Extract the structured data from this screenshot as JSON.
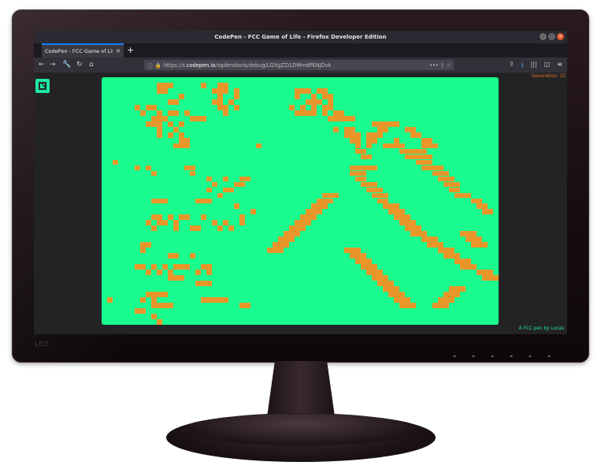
{
  "browser": {
    "window_title": "CodePen - FCC Game of Life - Firefox Developer Edition",
    "tab_title": "CodePen - FCC Game of Life",
    "tab_close": "✕",
    "new_tab": "+",
    "url_prefix": "https://s.",
    "url_domain": "codepen.io",
    "url_path": "/ogdendavis/debug/LQXgZZ/LDMmdPENJDvk",
    "nav": {
      "back": "←",
      "forward": "→",
      "tools": "🔧",
      "reload": "↻",
      "home": "⌂"
    },
    "url_icons": {
      "info": "ⓘ",
      "lock": "🔒",
      "more": "•••",
      "pocket": "◊",
      "star": "☆"
    },
    "right_icons": {
      "share": "⇪",
      "download": "⭳",
      "library": "|||",
      "sidebar": "◫",
      "menu": "≡"
    },
    "win_controls": [
      "–",
      "□",
      "✕"
    ]
  },
  "app": {
    "generation_label": "Generation: 33",
    "footer": "A FCC pen by Lucas",
    "colors": {
      "board": "#19fb8e",
      "cell": "#e8962a",
      "accent": "#1de9a0",
      "generation": "#e07020"
    },
    "board_cols": 72,
    "board_rows": 45,
    "live_cells": [
      [
        10,
        1
      ],
      [
        11,
        1
      ],
      [
        12,
        1
      ],
      [
        18,
        1
      ],
      [
        21,
        1
      ],
      [
        22,
        1
      ],
      [
        10,
        2
      ],
      [
        11,
        2
      ],
      [
        20,
        2
      ],
      [
        21,
        2
      ],
      [
        22,
        2
      ],
      [
        24,
        2
      ],
      [
        14,
        3
      ],
      [
        21,
        3
      ],
      [
        24,
        3
      ],
      [
        12,
        4
      ],
      [
        13,
        4
      ],
      [
        20,
        4
      ],
      [
        21,
        4
      ],
      [
        23,
        4
      ],
      [
        6,
        5
      ],
      [
        8,
        5
      ],
      [
        9,
        5
      ],
      [
        21,
        5
      ],
      [
        22,
        5
      ],
      [
        24,
        5
      ],
      [
        7,
        6
      ],
      [
        10,
        6
      ],
      [
        12,
        6
      ],
      [
        13,
        6
      ],
      [
        15,
        6
      ],
      [
        22,
        6
      ],
      [
        9,
        7
      ],
      [
        10,
        7
      ],
      [
        11,
        7
      ],
      [
        16,
        7
      ],
      [
        17,
        7
      ],
      [
        18,
        7
      ],
      [
        8,
        8
      ],
      [
        9,
        8
      ],
      [
        10,
        8
      ],
      [
        12,
        8
      ],
      [
        14,
        8
      ],
      [
        10,
        9
      ],
      [
        13,
        9
      ],
      [
        10,
        10
      ],
      [
        12,
        10
      ],
      [
        14,
        10
      ],
      [
        14,
        11
      ],
      [
        15,
        11
      ],
      [
        13,
        12
      ],
      [
        14,
        12
      ],
      [
        15,
        12
      ],
      [
        28,
        12
      ],
      [
        2,
        15
      ],
      [
        6,
        16
      ],
      [
        8,
        16
      ],
      [
        15,
        16
      ],
      [
        16,
        16
      ],
      [
        9,
        17
      ],
      [
        16,
        17
      ],
      [
        19,
        18
      ],
      [
        22,
        18
      ],
      [
        25,
        18
      ],
      [
        26,
        18
      ],
      [
        20,
        19
      ],
      [
        24,
        19
      ],
      [
        25,
        19
      ],
      [
        19,
        20
      ],
      [
        22,
        20
      ],
      [
        23,
        20
      ],
      [
        21,
        21
      ],
      [
        9,
        22
      ],
      [
        10,
        22
      ],
      [
        11,
        22
      ],
      [
        17,
        22
      ],
      [
        18,
        22
      ],
      [
        19,
        22
      ],
      [
        24,
        23
      ],
      [
        27,
        24
      ],
      [
        9,
        25
      ],
      [
        10,
        25
      ],
      [
        12,
        25
      ],
      [
        14,
        25
      ],
      [
        15,
        25
      ],
      [
        18,
        25
      ],
      [
        25,
        25
      ],
      [
        8,
        26
      ],
      [
        10,
        26
      ],
      [
        11,
        26
      ],
      [
        13,
        26
      ],
      [
        20,
        26
      ],
      [
        22,
        26
      ],
      [
        25,
        26
      ],
      [
        9,
        27
      ],
      [
        13,
        27
      ],
      [
        16,
        27
      ],
      [
        17,
        27
      ],
      [
        21,
        27
      ],
      [
        23,
        27
      ],
      [
        7,
        30
      ],
      [
        8,
        30
      ],
      [
        7,
        31
      ],
      [
        12,
        32
      ],
      [
        13,
        32
      ],
      [
        16,
        32
      ],
      [
        6,
        34
      ],
      [
        7,
        34
      ],
      [
        9,
        34
      ],
      [
        11,
        34
      ],
      [
        13,
        34
      ],
      [
        14,
        34
      ],
      [
        15,
        34
      ],
      [
        18,
        34
      ],
      [
        19,
        34
      ],
      [
        8,
        35
      ],
      [
        10,
        35
      ],
      [
        12,
        35
      ],
      [
        17,
        35
      ],
      [
        19,
        35
      ],
      [
        12,
        36
      ],
      [
        13,
        36
      ],
      [
        14,
        36
      ],
      [
        17,
        37
      ],
      [
        18,
        37
      ],
      [
        19,
        37
      ],
      [
        8,
        39
      ],
      [
        9,
        39
      ],
      [
        10,
        39
      ],
      [
        11,
        39
      ],
      [
        7,
        40
      ],
      [
        9,
        40
      ],
      [
        9,
        41
      ],
      [
        10,
        41
      ],
      [
        11,
        41
      ],
      [
        12,
        41
      ],
      [
        1,
        40
      ],
      [
        6,
        42
      ],
      [
        7,
        42
      ],
      [
        18,
        40
      ],
      [
        19,
        40
      ],
      [
        20,
        40
      ],
      [
        21,
        40
      ],
      [
        22,
        40
      ],
      [
        25,
        41
      ],
      [
        26,
        41
      ],
      [
        9,
        43
      ],
      [
        10,
        44
      ],
      [
        35,
        2
      ],
      [
        36,
        2
      ],
      [
        37,
        2
      ],
      [
        39,
        2
      ],
      [
        40,
        2
      ],
      [
        35,
        3
      ],
      [
        38,
        3
      ],
      [
        40,
        3
      ],
      [
        41,
        3
      ],
      [
        37,
        4
      ],
      [
        38,
        4
      ],
      [
        39,
        4
      ],
      [
        41,
        4
      ],
      [
        34,
        5
      ],
      [
        36,
        5
      ],
      [
        38,
        5
      ],
      [
        40,
        5
      ],
      [
        41,
        5
      ],
      [
        35,
        6
      ],
      [
        36,
        6
      ],
      [
        37,
        6
      ],
      [
        38,
        6
      ],
      [
        40,
        6
      ],
      [
        42,
        6
      ],
      [
        43,
        6
      ],
      [
        41,
        7
      ],
      [
        42,
        7
      ],
      [
        43,
        7
      ],
      [
        44,
        7
      ],
      [
        45,
        7
      ],
      [
        49,
        8
      ],
      [
        50,
        8
      ],
      [
        51,
        8
      ],
      [
        52,
        8
      ],
      [
        53,
        8
      ],
      [
        42,
        9
      ],
      [
        44,
        9
      ],
      [
        45,
        9
      ],
      [
        50,
        9
      ],
      [
        51,
        9
      ],
      [
        55,
        9
      ],
      [
        56,
        9
      ],
      [
        44,
        10
      ],
      [
        45,
        10
      ],
      [
        46,
        10
      ],
      [
        48,
        10
      ],
      [
        49,
        10
      ],
      [
        50,
        10
      ],
      [
        56,
        10
      ],
      [
        57,
        10
      ],
      [
        45,
        11
      ],
      [
        46,
        11
      ],
      [
        48,
        11
      ],
      [
        49,
        11
      ],
      [
        53,
        11
      ],
      [
        58,
        11
      ],
      [
        59,
        11
      ],
      [
        46,
        12
      ],
      [
        48,
        12
      ],
      [
        51,
        12
      ],
      [
        52,
        12
      ],
      [
        53,
        12
      ],
      [
        54,
        12
      ],
      [
        58,
        12
      ],
      [
        59,
        12
      ],
      [
        60,
        12
      ],
      [
        46,
        13
      ],
      [
        47,
        13
      ],
      [
        54,
        13
      ],
      [
        55,
        13
      ],
      [
        56,
        13
      ],
      [
        57,
        13
      ],
      [
        58,
        13
      ],
      [
        47,
        14
      ],
      [
        48,
        14
      ],
      [
        55,
        14
      ],
      [
        56,
        14
      ],
      [
        57,
        14
      ],
      [
        58,
        14
      ],
      [
        59,
        14
      ],
      [
        57,
        15
      ],
      [
        58,
        15
      ],
      [
        59,
        15
      ],
      [
        45,
        16
      ],
      [
        46,
        16
      ],
      [
        47,
        16
      ],
      [
        48,
        16
      ],
      [
        49,
        16
      ],
      [
        58,
        16
      ],
      [
        59,
        16
      ],
      [
        60,
        16
      ],
      [
        61,
        16
      ],
      [
        45,
        17
      ],
      [
        46,
        17
      ],
      [
        47,
        17
      ],
      [
        60,
        17
      ],
      [
        61,
        17
      ],
      [
        62,
        17
      ],
      [
        46,
        18
      ],
      [
        47,
        18
      ],
      [
        61,
        18
      ],
      [
        62,
        18
      ],
      [
        63,
        18
      ],
      [
        47,
        19
      ],
      [
        48,
        19
      ],
      [
        49,
        19
      ],
      [
        62,
        19
      ],
      [
        63,
        19
      ],
      [
        64,
        19
      ],
      [
        48,
        20
      ],
      [
        49,
        20
      ],
      [
        50,
        20
      ],
      [
        63,
        20
      ],
      [
        64,
        20
      ],
      [
        49,
        21
      ],
      [
        50,
        21
      ],
      [
        51,
        21
      ],
      [
        64,
        21
      ],
      [
        65,
        21
      ],
      [
        66,
        21
      ],
      [
        50,
        22
      ],
      [
        51,
        22
      ],
      [
        67,
        22
      ],
      [
        68,
        22
      ],
      [
        51,
        23
      ],
      [
        52,
        23
      ],
      [
        53,
        23
      ],
      [
        68,
        23
      ],
      [
        69,
        23
      ],
      [
        52,
        24
      ],
      [
        53,
        24
      ],
      [
        54,
        24
      ],
      [
        69,
        24
      ],
      [
        70,
        24
      ],
      [
        53,
        25
      ],
      [
        54,
        25
      ],
      [
        55,
        25
      ],
      [
        54,
        26
      ],
      [
        55,
        26
      ],
      [
        56,
        26
      ],
      [
        55,
        27
      ],
      [
        56,
        27
      ],
      [
        57,
        27
      ],
      [
        56,
        28
      ],
      [
        57,
        28
      ],
      [
        58,
        28
      ],
      [
        58,
        29
      ],
      [
        59,
        29
      ],
      [
        60,
        29
      ],
      [
        59,
        30
      ],
      [
        60,
        30
      ],
      [
        61,
        30
      ],
      [
        61,
        31
      ],
      [
        62,
        31
      ],
      [
        63,
        31
      ],
      [
        62,
        32
      ],
      [
        63,
        32
      ],
      [
        64,
        32
      ],
      [
        64,
        33
      ],
      [
        65,
        33
      ],
      [
        66,
        33
      ],
      [
        65,
        34
      ],
      [
        66,
        34
      ],
      [
        67,
        34
      ],
      [
        68,
        35
      ],
      [
        69,
        35
      ],
      [
        70,
        35
      ],
      [
        69,
        36
      ],
      [
        70,
        36
      ],
      [
        71,
        36
      ],
      [
        40,
        21
      ],
      [
        41,
        21
      ],
      [
        42,
        21
      ],
      [
        39,
        22
      ],
      [
        40,
        22
      ],
      [
        41,
        22
      ],
      [
        38,
        23
      ],
      [
        39,
        23
      ],
      [
        40,
        23
      ],
      [
        37,
        24
      ],
      [
        38,
        24
      ],
      [
        39,
        24
      ],
      [
        36,
        25
      ],
      [
        37,
        25
      ],
      [
        38,
        25
      ],
      [
        35,
        26
      ],
      [
        36,
        26
      ],
      [
        37,
        26
      ],
      [
        34,
        27
      ],
      [
        35,
        27
      ],
      [
        36,
        27
      ],
      [
        33,
        28
      ],
      [
        34,
        28
      ],
      [
        35,
        28
      ],
      [
        32,
        29
      ],
      [
        33,
        29
      ],
      [
        34,
        29
      ],
      [
        31,
        30
      ],
      [
        32,
        30
      ],
      [
        33,
        30
      ],
      [
        30,
        31
      ],
      [
        31,
        31
      ],
      [
        32,
        31
      ],
      [
        44,
        31
      ],
      [
        45,
        31
      ],
      [
        46,
        31
      ],
      [
        45,
        32
      ],
      [
        46,
        32
      ],
      [
        47,
        32
      ],
      [
        46,
        33
      ],
      [
        47,
        33
      ],
      [
        48,
        33
      ],
      [
        47,
        34
      ],
      [
        48,
        34
      ],
      [
        49,
        34
      ],
      [
        48,
        35
      ],
      [
        49,
        35
      ],
      [
        50,
        35
      ],
      [
        49,
        36
      ],
      [
        50,
        36
      ],
      [
        51,
        36
      ],
      [
        50,
        37
      ],
      [
        51,
        37
      ],
      [
        52,
        37
      ],
      [
        51,
        38
      ],
      [
        52,
        38
      ],
      [
        53,
        38
      ],
      [
        52,
        39
      ],
      [
        53,
        39
      ],
      [
        54,
        39
      ],
      [
        53,
        40
      ],
      [
        54,
        40
      ],
      [
        55,
        40
      ],
      [
        54,
        41
      ],
      [
        55,
        41
      ],
      [
        56,
        41
      ],
      [
        63,
        38
      ],
      [
        64,
        38
      ],
      [
        65,
        38
      ],
      [
        62,
        39
      ],
      [
        63,
        39
      ],
      [
        64,
        39
      ],
      [
        61,
        40
      ],
      [
        62,
        40
      ],
      [
        63,
        40
      ],
      [
        60,
        41
      ],
      [
        61,
        41
      ],
      [
        62,
        41
      ],
      [
        65,
        28
      ],
      [
        66,
        28
      ],
      [
        67,
        28
      ],
      [
        66,
        29
      ],
      [
        67,
        29
      ],
      [
        68,
        29
      ],
      [
        67,
        30
      ],
      [
        68,
        30
      ],
      [
        69,
        30
      ]
    ]
  }
}
